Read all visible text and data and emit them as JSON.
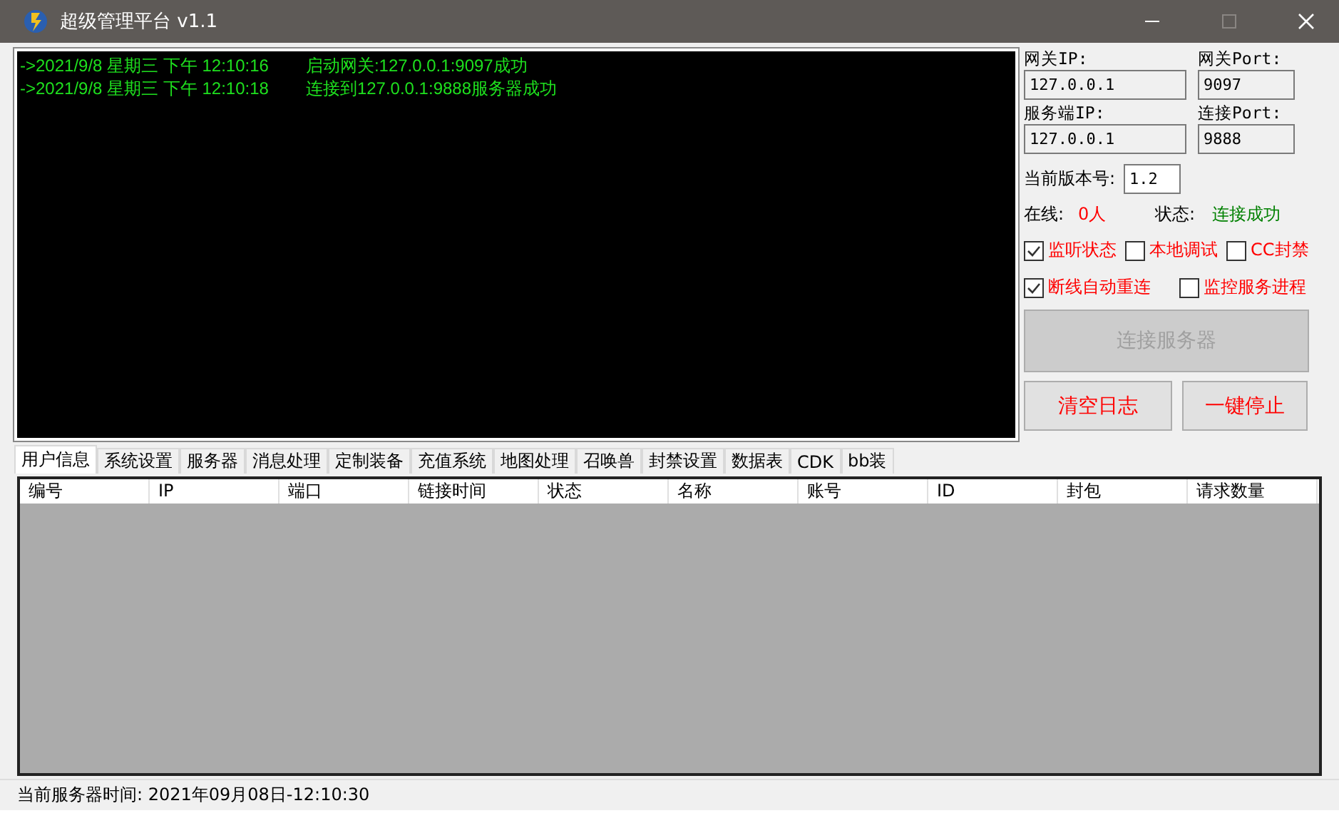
{
  "window": {
    "title": "超级管理平台 v1.1"
  },
  "log": [
    {
      "time": "->2021/9/8 星期三 下午 12:10:16",
      "message": "启动网关:127.0.0.1:9097成功"
    },
    {
      "time": "->2021/9/8 星期三 下午 12:10:18",
      "message": "连接到127.0.0.1:9888服务器成功"
    }
  ],
  "settings": {
    "gateway_ip_label": "网关IP:",
    "gateway_ip": "127.0.0.1",
    "gateway_port_label": "网关Port:",
    "gateway_port": "9097",
    "server_ip_label": "服务端IP:",
    "server_ip": "127.0.0.1",
    "connect_port_label": "连接Port:",
    "connect_port": "9888",
    "version_label": "当前版本号:",
    "version": "1.2",
    "online_label": "在线:",
    "online": "0人",
    "status_label": "状态:",
    "status": "连接成功"
  },
  "checkboxes": [
    {
      "label": "监听状态",
      "checked": true
    },
    {
      "label": "本地调试",
      "checked": false
    },
    {
      "label": "CC封禁",
      "checked": false
    },
    {
      "label": "断线自动重连",
      "checked": true
    },
    {
      "label": "监控服务进程",
      "checked": false
    }
  ],
  "buttons": {
    "connect": {
      "label": "连接服务器",
      "disabled": true
    },
    "clear": "清空日志",
    "stop": "一键停止"
  },
  "tabs": [
    {
      "label": "用户信息",
      "selected": true
    },
    {
      "label": "系统设置",
      "selected": false
    },
    {
      "label": "服务器",
      "selected": false
    },
    {
      "label": "消息处理",
      "selected": false
    },
    {
      "label": "定制装备",
      "selected": false
    },
    {
      "label": "充值系统",
      "selected": false
    },
    {
      "label": "地图处理",
      "selected": false
    },
    {
      "label": "召唤兽",
      "selected": false
    },
    {
      "label": "封禁设置",
      "selected": false
    },
    {
      "label": "数据表",
      "selected": false
    },
    {
      "label": "CDK",
      "selected": false
    },
    {
      "label": "bb装",
      "selected": false
    }
  ],
  "table": {
    "columns": [
      "编号",
      "IP",
      "端口",
      "链接时间",
      "状态",
      "名称",
      "账号",
      "ID",
      "封包",
      "请求数量"
    ]
  },
  "status_bar": {
    "text": "当前服务器时间:  2021年09月08日-12:10:30"
  }
}
